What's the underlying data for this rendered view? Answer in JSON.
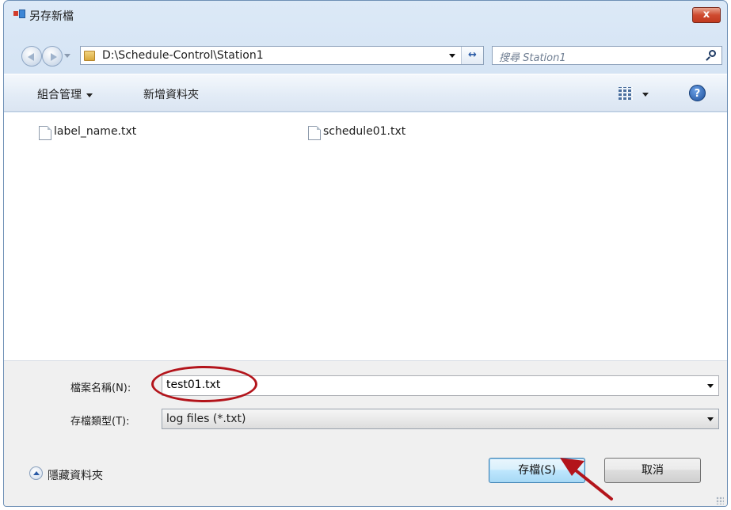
{
  "window": {
    "title": "另存新檔",
    "close_label": "x"
  },
  "address_bar": {
    "path": "D:\\Schedule-Control\\Station1",
    "search_placeholder": "搜尋 Station1"
  },
  "toolbar": {
    "organize_label": "組合管理",
    "new_folder_label": "新增資料夾"
  },
  "files": [
    {
      "name": "label_name.txt"
    },
    {
      "name": "schedule01.txt"
    }
  ],
  "form": {
    "filename_label": "檔案名稱(N):",
    "filename_value": "test01.txt",
    "filetype_label": "存檔類型(T):",
    "filetype_value": "log files (*.txt)"
  },
  "footer": {
    "hide_folders_label": "隱藏資料夾",
    "save_label": "存檔(S)",
    "cancel_label": "取消"
  },
  "colors": {
    "annotation": "#b3141b",
    "window_frame": "#c4d6ec"
  }
}
